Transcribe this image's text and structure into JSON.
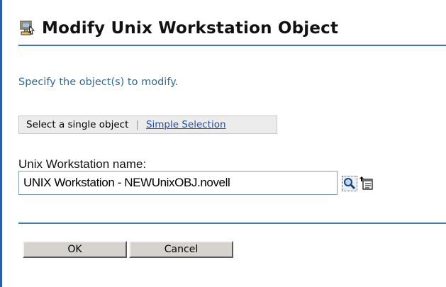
{
  "dialog": {
    "title": "Modify Unix Workstation Object",
    "title_icon": "workstation-icon",
    "instruction": "Specify the object(s) to modify."
  },
  "selection_mode": {
    "active_label": "Select a single object",
    "separator": "|",
    "alternate_link": "Simple Selection"
  },
  "field": {
    "label": "Unix Workstation name:",
    "value": "UNIX Workstation - NEWUnixOBJ.novell",
    "search_icon": "magnifier-icon",
    "browse_icon": "object-browser-icon"
  },
  "buttons": {
    "ok": "OK",
    "cancel": "Cancel"
  },
  "colors": {
    "accent_rule": "#4575b4",
    "instruction_text": "#2e6b96",
    "link": "#1f4fa3"
  }
}
